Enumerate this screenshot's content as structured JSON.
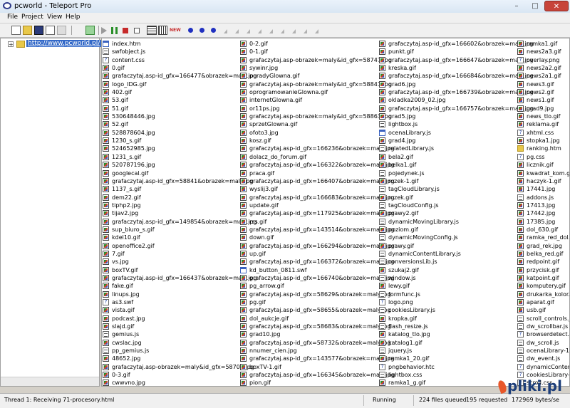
{
  "window": {
    "title": "pcworld - Teleport Pro",
    "min": "–",
    "max": "□",
    "close": "✕"
  },
  "menu": [
    {
      "label": "File",
      "key": "F",
      "rest": "ile"
    },
    {
      "label": "Project",
      "key": "P",
      "rest": "roject"
    },
    {
      "label": "View",
      "key": "V",
      "rest": "iew"
    },
    {
      "label": "Help",
      "key": "H",
      "rest": "elp"
    }
  ],
  "toolbar": {
    "icons": [
      "new-project-icon",
      "open-folder-icon",
      "save-icon",
      "save-as-icon",
      "properties-icon",
      "browse-icon",
      "start-icon",
      "pause-icon",
      "stop-icon",
      "record-icon",
      "list-view-icon",
      "grid-view-icon",
      "new-badge-icon",
      "dot-1-icon",
      "dot-2-icon",
      "dot-3-icon"
    ]
  },
  "tree": {
    "expander": "+",
    "root_url": "http://www.pcworld.pl/"
  },
  "columns": [
    [
      [
        "index.htm",
        "win"
      ],
      [
        "swfobject.js",
        "doc"
      ],
      [
        "content.css",
        "unk"
      ],
      [
        "0.gif",
        "img"
      ],
      [
        "grafaczytaj.asp-id_gfx=166477&obrazek=maly.jpg",
        "img"
      ],
      [
        "logo_IDG.gif",
        "img"
      ],
      [
        "402.gif",
        "img"
      ],
      [
        "53.gif",
        "img"
      ],
      [
        "51.gif",
        "img"
      ],
      [
        "530648446.jpg",
        "img"
      ],
      [
        "52.gif",
        "img"
      ],
      [
        "528878604.jpg",
        "img"
      ],
      [
        "1230_s.gif",
        "img"
      ],
      [
        "524652985.jpg",
        "img"
      ],
      [
        "1231_s.gif",
        "img"
      ],
      [
        "520787196.jpg",
        "img"
      ],
      [
        "googlecal.gif",
        "img"
      ],
      [
        "grafaczytaj.asp-id_gfx=58841&obrazek=maly.jpg",
        "img"
      ],
      [
        "1137_s.gif",
        "img"
      ],
      [
        "dem22.gif",
        "img"
      ],
      [
        "tiphp2.jpg",
        "img"
      ],
      [
        "tijav2.jpg",
        "img"
      ],
      [
        "grafaczytaj.asp-id_gfx=149854&obrazek=maly.jpg",
        "img"
      ],
      [
        "sup_biuro_s.gif",
        "img"
      ],
      [
        "kdel10.gif",
        "img"
      ],
      [
        "openoffice2.gif",
        "img"
      ],
      [
        "7.gif",
        "img"
      ],
      [
        "vs.jpg",
        "img"
      ],
      [
        "boxTV.gif",
        "img"
      ],
      [
        "grafaczytaj.asp-id_gfx=166437&obrazek=maly.jpg",
        "img"
      ],
      [
        "fake.gif",
        "img"
      ],
      [
        "linups.jpg",
        "img"
      ],
      [
        "as3.swf",
        "unk"
      ],
      [
        "vista.gif",
        "img"
      ],
      [
        "podcast.jpg",
        "img"
      ],
      [
        "slajd.gif",
        "img"
      ],
      [
        "gemius.js",
        "doc"
      ],
      [
        "cwslac.jpg",
        "img"
      ],
      [
        "pp_gemius.js",
        "doc"
      ],
      [
        "48652.jpg",
        "img"
      ],
      [
        "grafaczytaj.asp-obrazek=maly&id_gfx=58707.jpg",
        "img"
      ],
      [
        "0-3.gif",
        "img"
      ],
      [
        "cwwvno.jpg",
        "img"
      ]
    ],
    [
      [
        "0-2.gif",
        "img"
      ],
      [
        "0-1.gif",
        "img"
      ],
      [
        "grafaczytaj.asp-obrazek=maly&id_gfx=58747.jpg",
        "img"
      ],
      [
        "sywinr.jpg",
        "img"
      ],
      [
        "poradyGlowna.gif",
        "img"
      ],
      [
        "grafaczytaj.asp-obrazek=maly&id_gfx=58841.jpg",
        "img"
      ],
      [
        "oprogramowanieGlowna.gif",
        "img"
      ],
      [
        "internetGlowna.gif",
        "img"
      ],
      [
        "or11ps.jpg",
        "img"
      ],
      [
        "grafaczytaj.asp-obrazek=maly&id_gfx=58863.jpg",
        "img"
      ],
      [
        "sprzetGlowna.gif",
        "img"
      ],
      [
        "ofoto3.jpg",
        "img"
      ],
      [
        "kosz.gif",
        "img"
      ],
      [
        "grafaczytaj.asp-id_gfx=166236&obrazek=maly.jpg",
        "img"
      ],
      [
        "dolacz_do_forum.gif",
        "img"
      ],
      [
        "grafaczytaj.asp-id_gfx=166322&obrazek=maly.jpg",
        "img"
      ],
      [
        "praca.gif",
        "img"
      ],
      [
        "grafaczytaj.asp-id_gfx=166407&obrazek=maly.jpg",
        "img"
      ],
      [
        "wyslij3.gif",
        "img"
      ],
      [
        "grafaczytaj.asp-id_gfx=166683&obrazek=maly.jpg",
        "img"
      ],
      [
        "update.gif",
        "img"
      ],
      [
        "grafaczytaj.asp-id_gfx=117925&obrazek=maly.jpg",
        "img"
      ],
      [
        "rss.gif",
        "img"
      ],
      [
        "grafaczytaj.asp-id_gfx=143514&obrazek=maly.jpg",
        "img"
      ],
      [
        "down.gif",
        "img"
      ],
      [
        "grafaczytaj.asp-id_gfx=166294&obrazek=maly.jpg",
        "img"
      ],
      [
        "up.gif",
        "img"
      ],
      [
        "grafaczytaj.asp-id_gfx=166372&obrazek=maly.jpg",
        "img"
      ],
      [
        "kd_button_0811.swf",
        "win"
      ],
      [
        "grafaczytaj.asp-id_gfx=166740&obrazek=maly.jpg",
        "img"
      ],
      [
        "pg_arrow.gif",
        "img"
      ],
      [
        "grafaczytaj.asp-id_gfx=58629&obrazek=maly.jpg",
        "img"
      ],
      [
        "pg.gif",
        "img"
      ],
      [
        "grafaczytaj.asp-id_gfx=58655&obrazek=maly.jpg",
        "img"
      ],
      [
        "dol_aukcje.gif",
        "img"
      ],
      [
        "grafaczytaj.asp-id_gfx=58683&obrazek=maly.jpg",
        "img"
      ],
      [
        "grad10.jpg",
        "img"
      ],
      [
        "grafaczytaj.asp-id_gfx=58732&obrazek=maly.jpg",
        "img"
      ],
      [
        "nnumer_cien.jpg",
        "img"
      ],
      [
        "grafaczytaj.asp-id_gfx=143577&obrazek=maly.jpg",
        "img"
      ],
      [
        "boxTV-1.gif",
        "img"
      ],
      [
        "grafaczytaj.asp-id_gfx=166345&obrazek=maly.jpg",
        "img"
      ],
      [
        "pion.gif",
        "img"
      ]
    ],
    [
      [
        "grafaczytaj.asp-id_gfx=166602&obrazek=maly.jpg",
        "img"
      ],
      [
        "punkt.gif",
        "img"
      ],
      [
        "grafaczytaj.asp-id_gfx=166647&obrazek=maly.jpg",
        "img"
      ],
      [
        "kreska.gif",
        "img"
      ],
      [
        "grafaczytaj.asp-id_gfx=166684&obrazek=maly.jpg",
        "img"
      ],
      [
        "grad6.jpg",
        "img"
      ],
      [
        "grafaczytaj.asp-id_gfx=166739&obrazek=maly.jpg",
        "img"
      ],
      [
        "okladka2009_02.jpg",
        "img"
      ],
      [
        "grafaczytaj.asp-id_gfx=166757&obrazek=maly.jpg",
        "img"
      ],
      [
        "grad5.jpg",
        "img"
      ],
      [
        "lightbox.js",
        "doc"
      ],
      [
        "ocenaLibrary.js",
        "win"
      ],
      [
        "grad4.jpg",
        "img"
      ],
      [
        "relatedLibrary.js",
        "doc"
      ],
      [
        "bela2.gif",
        "img"
      ],
      [
        "belka1.gif",
        "img"
      ],
      [
        "pojedynek.js",
        "doc"
      ],
      [
        "rozek-1.gif",
        "img"
      ],
      [
        "tagCloudLibrary.js",
        "doc"
      ],
      [
        "rozek.gif",
        "img"
      ],
      [
        "tagCloudConfig.js",
        "doc"
      ],
      [
        "prawy2.gif",
        "img"
      ],
      [
        "dynamicMovingLibrary.js",
        "doc"
      ],
      [
        "poziom.gif",
        "img"
      ],
      [
        "dynamicMovingConfig.js",
        "doc"
      ],
      [
        "prawy.gif",
        "img"
      ],
      [
        "dynamicContentLibrary.js",
        "doc"
      ],
      [
        "conversionsLib.js",
        "doc"
      ],
      [
        "szukaj2.gif",
        "img"
      ],
      [
        "window.js",
        "doc"
      ],
      [
        "lewy.gif",
        "img"
      ],
      [
        "formfunc.js",
        "doc"
      ],
      [
        "logo.png",
        "unk"
      ],
      [
        "cookiesLibrary.js",
        "doc"
      ],
      [
        "kropka.gif",
        "img"
      ],
      [
        "flash_resize.js",
        "doc"
      ],
      [
        "katalog_tlo.jpg",
        "img"
      ],
      [
        "katalog1.gif",
        "img"
      ],
      [
        "jquery.js",
        "doc"
      ],
      [
        "ramka1_20.gif",
        "img"
      ],
      [
        "pngbehavior.htc",
        "unk"
      ],
      [
        "lightbox.css",
        "doc"
      ],
      [
        "ramka1_g.gif",
        "img"
      ]
    ],
    [
      [
        "ramka1.gif",
        "img"
      ],
      [
        "news2a3.gif",
        "img"
      ],
      [
        "overlay.png",
        "unk"
      ],
      [
        "news2a2.gif",
        "img"
      ],
      [
        "news2a1.gif",
        "img"
      ],
      [
        "news3.gif",
        "img"
      ],
      [
        "news2.gif",
        "img"
      ],
      [
        "news1.gif",
        "img"
      ],
      [
        "grad9.jpg",
        "img"
      ],
      [
        "news_tlo.gif",
        "img"
      ],
      [
        "reklama.gif",
        "img"
      ],
      [
        "xhtml.css",
        "unk"
      ],
      [
        "stopka1.jpg",
        "img"
      ],
      [
        "ranking.htm",
        "fold"
      ],
      [
        "pg.css",
        "unk"
      ],
      [
        "licznik.gif",
        "img"
      ],
      [
        "kwadrat_kom.g",
        "img"
      ],
      [
        "haczyk-1.gif",
        "img"
      ],
      [
        "17441.jpg",
        "img"
      ],
      [
        "addons.js",
        "doc"
      ],
      [
        "17413.jpg",
        "img"
      ],
      [
        "17442.jpg",
        "img"
      ],
      [
        "17385.jpg",
        "img"
      ],
      [
        "dol_630.gif",
        "img"
      ],
      [
        "ramka_red_dol.",
        "img"
      ],
      [
        "grad_rek.jpg",
        "img"
      ],
      [
        "belka_red.gif",
        "img"
      ],
      [
        "redpoint.gif",
        "img"
      ],
      [
        "przycisk.gif",
        "img"
      ],
      [
        "katpoint.gif",
        "img"
      ],
      [
        "komputery.gif",
        "img"
      ],
      [
        "drukarka_kolor.",
        "img"
      ],
      [
        "aparat.gif",
        "img"
      ],
      [
        "usb.gif",
        "img"
      ],
      [
        "scroll_controls.j",
        "doc"
      ],
      [
        "dw_scrollbar.js",
        "doc"
      ],
      [
        "browserdetect.j",
        "unk"
      ],
      [
        "dw_scroll.js",
        "doc"
      ],
      [
        "ocenaLibrary-1.",
        "doc"
      ],
      [
        "dw_event.js",
        "doc"
      ],
      [
        "dynamicConter",
        "unk"
      ],
      [
        "cookiesLibrary-",
        "unk"
      ],
      [
        "scroll.css",
        "unk"
      ]
    ]
  ],
  "status": {
    "thread": "Thread 1: Receiving 71-procesory.html",
    "state": "Running",
    "queued": "224 files queued",
    "requested": "195 requested",
    "rate": "172969 bytes/se"
  },
  "watermark": "pliki.pl"
}
